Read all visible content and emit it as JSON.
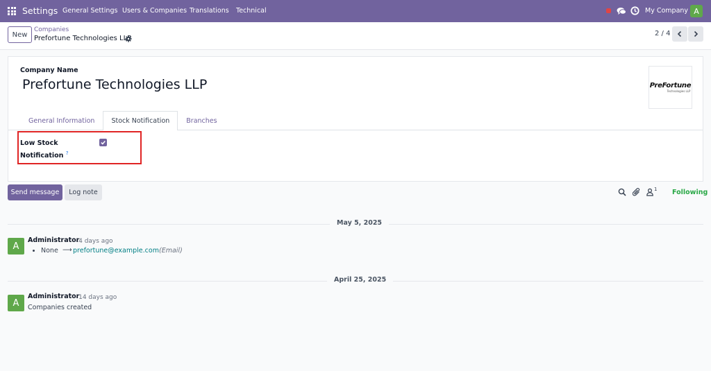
{
  "navbar": {
    "app_name": "Settings",
    "menu": [
      "General Settings",
      "Users & Companies",
      "Translations",
      "Technical"
    ],
    "company": "My Company",
    "user_initial": "A"
  },
  "control": {
    "new_label": "New",
    "breadcrumb_parent": "Companies",
    "breadcrumb_current": "Prefortune Technologies LLP",
    "pager": "2 / 4"
  },
  "form": {
    "company_name_label": "Company Name",
    "company_name": "Prefortune Technologies LLP",
    "logo_text": "PreFortune",
    "logo_sub": "Technologies LLP",
    "tabs": [
      "General Information",
      "Stock Notification",
      "Branches"
    ],
    "active_tab": "Stock Notification",
    "low_stock_label_1": "Low Stock",
    "low_stock_label_2": "Notification",
    "low_stock_help": "?",
    "low_stock_checked": true
  },
  "chatter": {
    "send_message": "Send message",
    "log_note": "Log note",
    "follower_count": "1",
    "following": "Following",
    "groups": [
      {
        "date": "May 5, 2025",
        "author": "Administrator",
        "time": "- 4 days ago",
        "old_value": "None",
        "arrow": "⟶",
        "new_value": "prefortune@example.com",
        "field": "(Email)"
      },
      {
        "date": "April 25, 2025",
        "author": "Administrator",
        "time": "- 14 days ago",
        "body": "Companies created"
      }
    ]
  },
  "colors": {
    "brand": "#71639e",
    "avatar": "#5fa84a",
    "following": "#28a745",
    "highlight": "#e02424"
  }
}
